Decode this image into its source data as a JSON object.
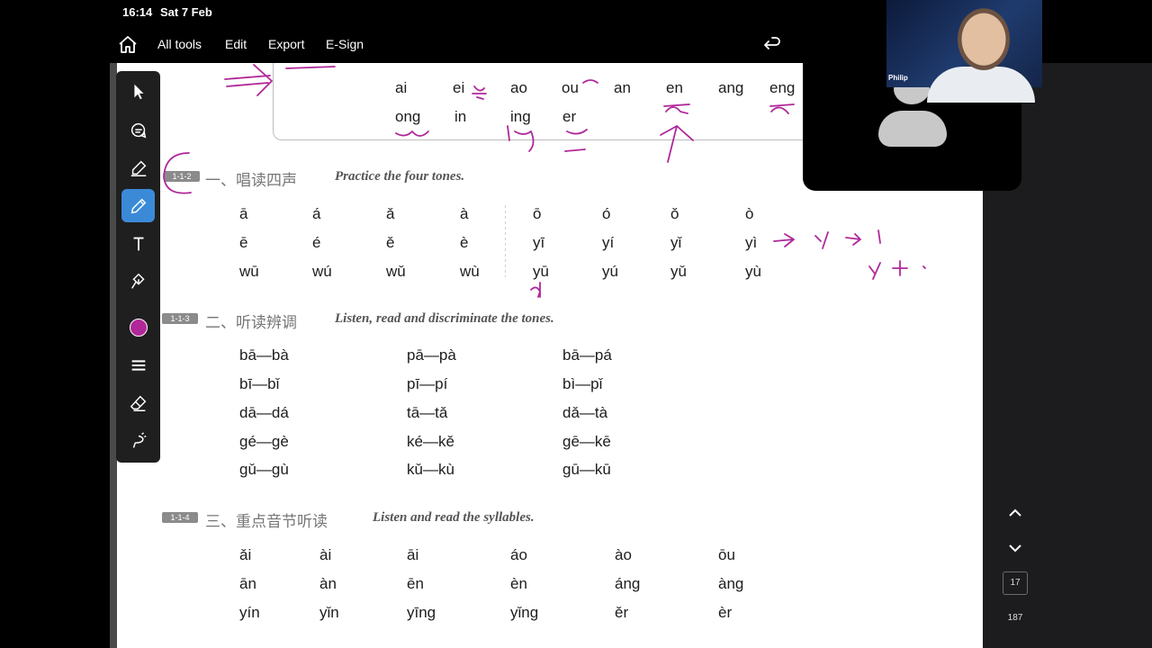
{
  "status": {
    "time": "16:14",
    "date": "Sat 7 Feb"
  },
  "toolbar": {
    "items": [
      "All tools",
      "Edit",
      "Export",
      "E-Sign"
    ]
  },
  "top_table": {
    "row1": [
      "ai",
      "ei",
      "ao",
      "ou",
      "an",
      "en",
      "ang",
      "eng"
    ],
    "row2": [
      "ong",
      "in",
      "ing",
      "er"
    ]
  },
  "section1": {
    "badge": "1-1-2",
    "cn": "一、唱读四声",
    "en": "Practice the four tones.",
    "rows": [
      [
        "ā",
        "á",
        "ǎ",
        "à",
        "ō",
        "ó",
        "ǒ",
        "ò"
      ],
      [
        "ē",
        "é",
        "ě",
        "è",
        "yī",
        "yí",
        "yǐ",
        "yì"
      ],
      [
        "wū",
        "wú",
        "wǔ",
        "wù",
        "yū",
        "yú",
        "yǔ",
        "yù"
      ]
    ]
  },
  "section2": {
    "badge": "1-1-3",
    "cn": "二、听读辨调",
    "en": "Listen, read and discriminate the tones.",
    "rows": [
      [
        "bā—bà",
        "pā—pà",
        "bā—pá"
      ],
      [
        "bī—bǐ",
        "pī—pí",
        "bì—pǐ"
      ],
      [
        "dā—dá",
        "tā—tǎ",
        "dǎ—tà"
      ],
      [
        "gé—gè",
        "ké—kě",
        "gē—kē"
      ],
      [
        "gǔ—gù",
        "kǔ—kù",
        "gū—kū"
      ]
    ]
  },
  "section3": {
    "badge": "1-1-4",
    "cn": "三、重点音节听读",
    "en": "Listen and read the syllables.",
    "rows": [
      [
        "ǎi",
        "ài",
        "āi",
        "áo",
        "ào",
        "ōu"
      ],
      [
        "ān",
        "àn",
        "ēn",
        "èn",
        "áng",
        "àng"
      ],
      [
        "yín",
        "yǐn",
        "yīng",
        "yǐng",
        "ěr",
        "èr"
      ]
    ]
  },
  "video": {
    "participant_name": "Philip"
  },
  "pager": {
    "current_page": "17",
    "total_pages": "187"
  },
  "palette": {
    "tools": [
      "select-tool",
      "comment-tool",
      "highlight-tool",
      "pen-tool",
      "text-tool",
      "sign-tool",
      "color-swatch",
      "line-weight-tool",
      "eraser-tool",
      "lasso-tool"
    ],
    "active_tool": "pen-tool",
    "ink_color": "#b0279a"
  }
}
